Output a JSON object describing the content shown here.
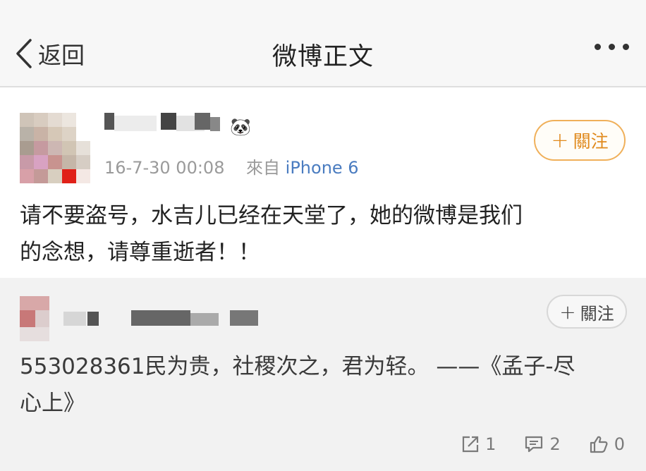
{
  "nav": {
    "back_label": "返回",
    "title": "微博正文",
    "back_icon": "chevron-left-icon",
    "more_icon": "more-dots-icon"
  },
  "post": {
    "timestamp": "16-7-30 00:08",
    "source_prefix": "來自",
    "source": "iPhone 6",
    "follow_label": "關注",
    "text_line1": "请不要盗号，水吉儿已经在天堂了，她的微博是我们",
    "text_line2": "的念想，请尊重逝者！！",
    "name_emoji": "🐼"
  },
  "repost": {
    "follow_label": "關注",
    "text_line1": "553028361民为贵，社稷次之，君为轻。 ——《孟子-尽",
    "text_line2": "心上》"
  },
  "actions": {
    "share_count": "1",
    "comment_count": "2",
    "like_count": "0"
  },
  "colors": {
    "follow_orange": "#e08a1e",
    "source_blue": "#4a7cc0",
    "repost_bg": "#f2f2f2"
  }
}
